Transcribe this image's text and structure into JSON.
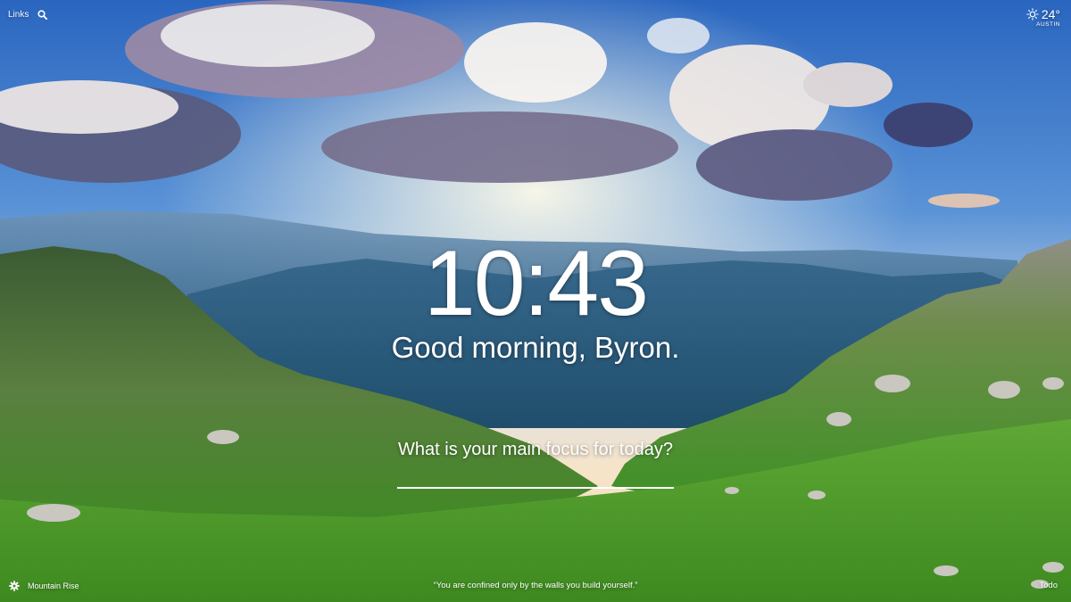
{
  "top_left": {
    "links_label": "Links",
    "search_icon": "search-icon"
  },
  "weather": {
    "icon": "sun-icon",
    "temperature": "24°",
    "location": "AUSTIN"
  },
  "center": {
    "time": "10:43",
    "greeting": "Good morning, Byron.",
    "focus_question": "What is your main focus for today?",
    "focus_value": ""
  },
  "bottom": {
    "settings_icon": "gear-icon",
    "photo_title": "Mountain Rise",
    "quote": "“You are confined only by the walls you build yourself.”",
    "todo_label": "Todo"
  },
  "colors": {
    "sky_top": "#2f6fc4",
    "sky_horizon": "#f4e3c8",
    "mountain_far": "#3d6f95",
    "grass": "#4f9a2e",
    "text": "#ffffff"
  }
}
